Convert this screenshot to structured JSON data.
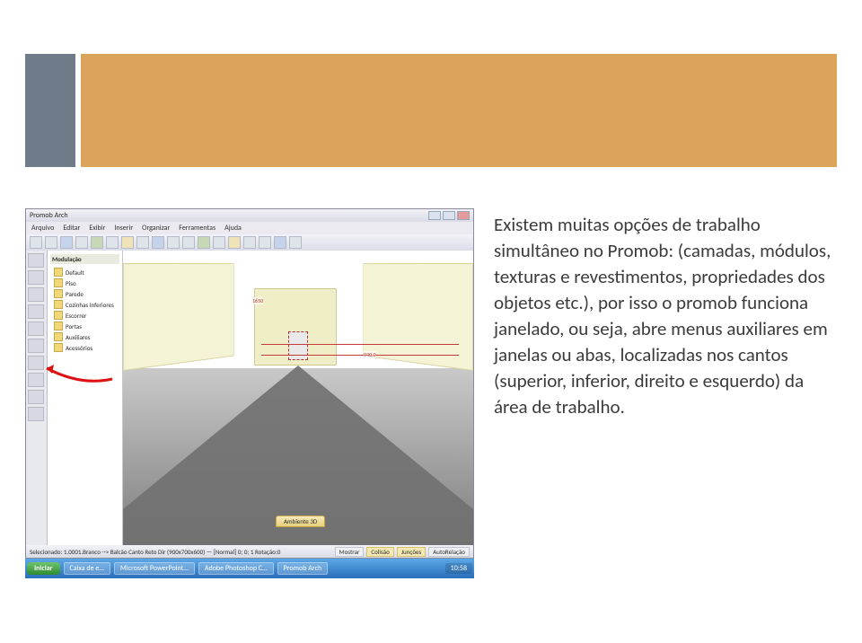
{
  "banner": {
    "accent_color": "#6f7b88",
    "main_color": "#dca35a"
  },
  "app": {
    "title": "Promob Arch",
    "menus": [
      "Arquivo",
      "Editar",
      "Exibir",
      "Inserir",
      "Organizar",
      "Ferramentas",
      "Ajuda"
    ],
    "tree": {
      "header": "Modulação",
      "items": [
        "Default",
        "Piso",
        "Parede",
        "Cozinhas Inferiores",
        "Escorrer",
        "Portas",
        "Auxiliares",
        "Acessórios"
      ]
    },
    "dims": {
      "a": "1650",
      "b": "940,0"
    },
    "view_tab": "Ambiente 3D",
    "status_left": "Selecionado: 1.0001.Branco --> Balcão Canto Reto Dir (900x700x600) — [Normal] 0; 0; 1 Rotação:0",
    "status_buttons": [
      "Mostrar",
      "Colisão",
      "Junções",
      "AutoRelação"
    ]
  },
  "taskbar": {
    "start": "Iniciar",
    "items": [
      "Caixa de e…",
      "Microsoft PowerPoint…",
      "Adobe Photoshop C…",
      "Promob Arch"
    ],
    "clock": "10:58"
  },
  "body_text": "Existem muitas opções de trabalho simultâneo no Promob: (camadas, módulos, texturas e revestimentos, propriedades dos objetos etc.), por isso o promob funciona janelado, ou seja, abre menus auxiliares em janelas ou abas, localizadas nos cantos (superior, inferior, direito e esquerdo) da área de trabalho."
}
